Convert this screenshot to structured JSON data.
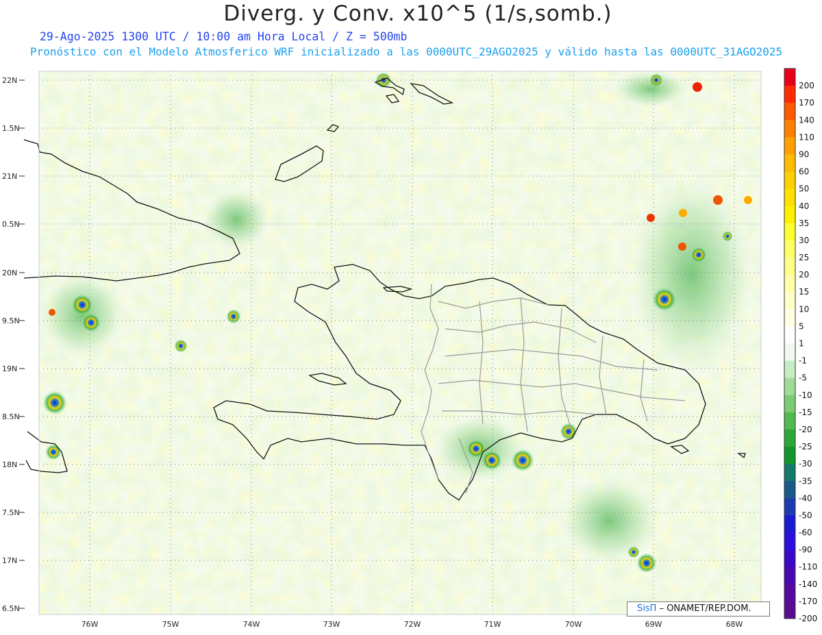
{
  "header": {
    "title": "Diverg. y Conv. x10^5 (1/s,somb.)",
    "subtitle": "29-Ago-2025  1300 UTC / 10:00 am Hora Local / Z = 500mb",
    "subtitle2": "Pronóstico con el Modelo Atmosferico WRF inicializado a las 0000UTC_29AGO2025 y válido hasta las  0000UTC_31AGO2025"
  },
  "map": {
    "lat_labels": [
      "22N",
      "1.5N",
      "21N",
      "0.5N",
      "20N",
      "9.5N",
      "19N",
      "8.5N",
      "18N",
      "7.5N",
      "17N",
      "6.5N"
    ],
    "lon_labels": [
      "76W",
      "75W",
      "74W",
      "73W",
      "72W",
      "71W",
      "70W",
      "69W",
      "68W"
    ],
    "field_colors": {
      "strong_convergence": "#1020c8",
      "moderate_convergence": "#2fa83a",
      "weak_convergence": "#b9e4b4",
      "neutral": "#f4fbf0",
      "weak_divergence": "#fffba0",
      "moderate_divergence": "#ffd400",
      "strong_divergence": "#ee2200",
      "coastline": "#111111",
      "boundaries": "#9a9a9a"
    }
  },
  "colorbar": {
    "labels": [
      "200",
      "170",
      "140",
      "110",
      "90",
      "60",
      "50",
      "40",
      "35",
      "30",
      "25",
      "20",
      "15",
      "10",
      "5",
      "1",
      "-1",
      "-5",
      "-10",
      "-15",
      "-20",
      "-25",
      "-30",
      "-35",
      "-40",
      "-50",
      "-60",
      "-90",
      "-110",
      "-140",
      "-170",
      "-200"
    ],
    "colors": [
      "#e8001a",
      "#ff2a00",
      "#ff5a00",
      "#ff8000",
      "#ffa000",
      "#ffbb00",
      "#ffd000",
      "#ffe000",
      "#fff000",
      "#ffff30",
      "#ffff66",
      "#ffff88",
      "#ffffaa",
      "#ffffc8",
      "#ffffe4",
      "#ffffff",
      "#f0faf0",
      "#c8ecc4",
      "#a0dc98",
      "#7ccc74",
      "#50ba50",
      "#2ca838",
      "#10962a",
      "#147a6a",
      "#185a8a",
      "#1a3cb0",
      "#1a1ad0",
      "#2a10e0",
      "#3c08c8",
      "#4a08b0",
      "#520aa0",
      "#5a0c90"
    ]
  },
  "credit": {
    "brand": "SisΠ",
    "text": "– ONAMET/REP.DOM."
  }
}
